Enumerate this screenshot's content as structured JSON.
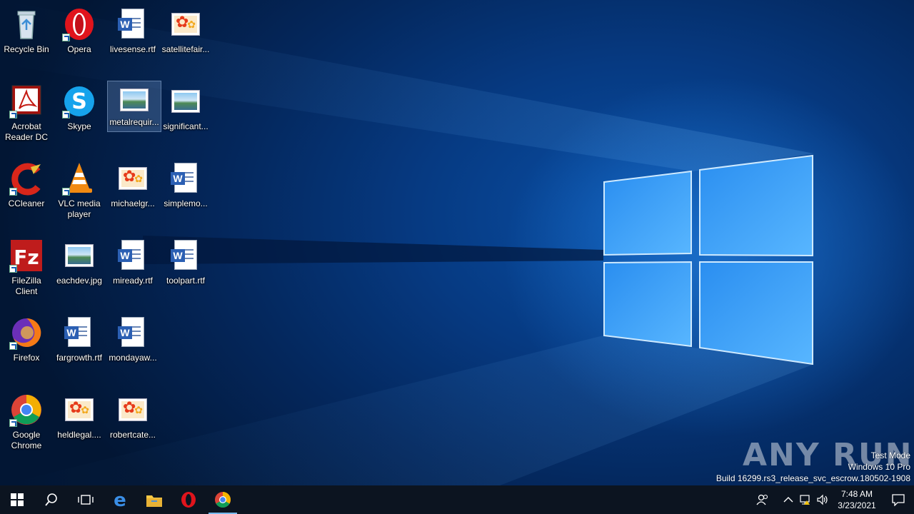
{
  "desktop": {
    "icons": [
      {
        "label": "Recycle Bin",
        "type": "recycle-bin"
      },
      {
        "label": "Opera",
        "type": "opera"
      },
      {
        "label": "livesense.rtf",
        "type": "rtf"
      },
      {
        "label": "satellitefair...",
        "type": "flower-image"
      },
      {
        "label": "Acrobat Reader DC",
        "type": "acrobat"
      },
      {
        "label": "Skype",
        "type": "skype"
      },
      {
        "label": "metalrequir...",
        "type": "landscape-image",
        "selected": true
      },
      {
        "label": "significant...",
        "type": "landscape-image"
      },
      {
        "label": "CCleaner",
        "type": "ccleaner"
      },
      {
        "label": "VLC media player",
        "type": "vlc"
      },
      {
        "label": "michaelgr...",
        "type": "flower-image"
      },
      {
        "label": "simplemo...",
        "type": "rtf"
      },
      {
        "label": "FileZilla Client",
        "type": "filezilla"
      },
      {
        "label": "eachdev.jpg",
        "type": "landscape-image"
      },
      {
        "label": "miready.rtf",
        "type": "rtf"
      },
      {
        "label": "toolpart.rtf",
        "type": "rtf"
      },
      {
        "label": "Firefox",
        "type": "firefox"
      },
      {
        "label": "fargrowth.rtf",
        "type": "rtf"
      },
      {
        "label": "mondayaw...",
        "type": "rtf"
      },
      {
        "label": "Google Chrome",
        "type": "chrome"
      },
      {
        "label": "heldlegal....",
        "type": "flower-image"
      },
      {
        "label": "robertcate...",
        "type": "flower-image"
      }
    ]
  },
  "watermark": {
    "line1": "Test Mode",
    "line2": "Windows 10 Pro",
    "line3": "Build 16299.rs3_release_svc_escrow.180502-1908",
    "brand": "ANY RUN"
  },
  "taskbar": {
    "buttons": [
      "start-icon",
      "search-icon",
      "task-view-icon",
      "edge-icon",
      "file-explorer-icon",
      "opera-icon",
      "chrome-icon"
    ],
    "active": "chrome-icon",
    "tray": [
      "people-icon",
      "chevron-up-icon",
      "network-icon",
      "volume-icon"
    ],
    "time": "7:48 AM",
    "date": "3/23/2021"
  }
}
